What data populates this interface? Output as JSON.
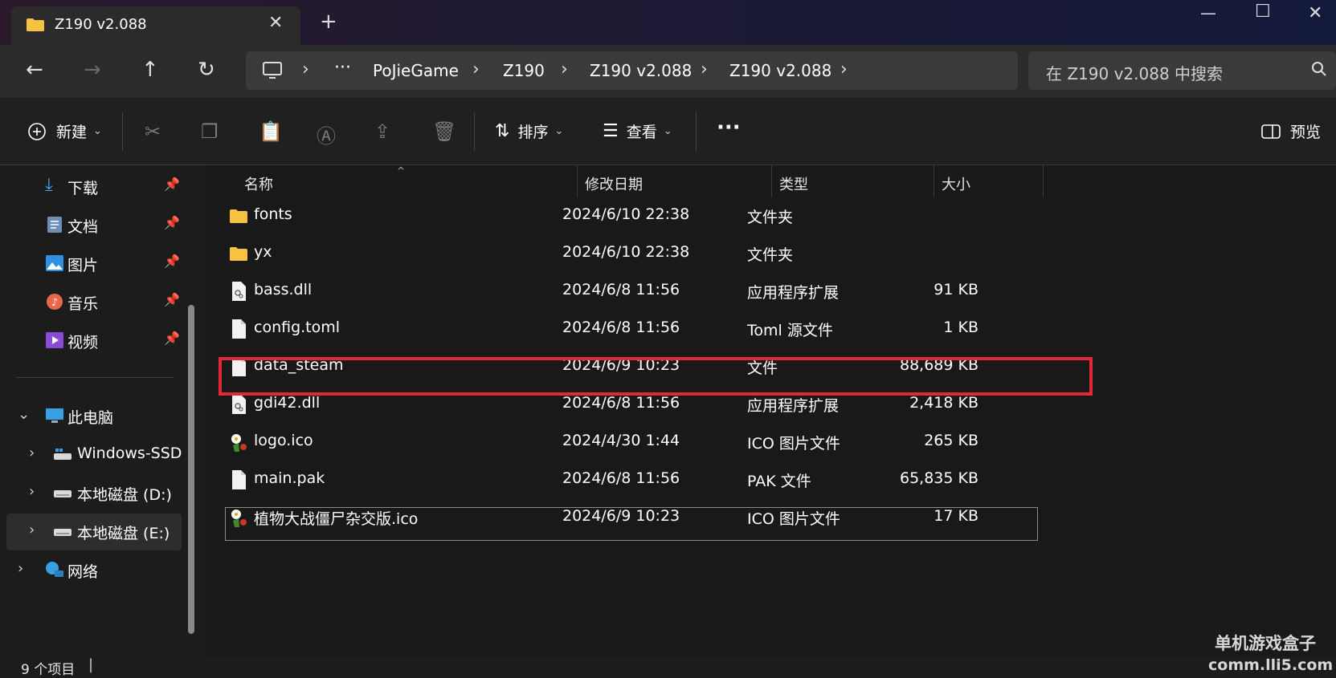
{
  "window": {
    "tab_title": "Z190 v2.088"
  },
  "breadcrumb": [
    "PoJieGame",
    "Z190",
    "Z190 v2.088",
    "Z190 v2.088"
  ],
  "search": {
    "placeholder": "在 Z190 v2.088 中搜索"
  },
  "toolbar": {
    "new_label": "新建",
    "sort_label": "排序",
    "view_label": "查看",
    "preview_label": "预览"
  },
  "sidebar": {
    "quick_access": [
      {
        "label": "下载",
        "icon": "download-icon"
      },
      {
        "label": "文档",
        "icon": "document-icon"
      },
      {
        "label": "图片",
        "icon": "picture-icon"
      },
      {
        "label": "音乐",
        "icon": "music-icon"
      },
      {
        "label": "视频",
        "icon": "video-icon"
      }
    ],
    "this_pc": "此电脑",
    "drives": [
      "Windows-SSD (",
      "本地磁盘 (D:)",
      "本地磁盘 (E:)"
    ],
    "network": "网络"
  },
  "columns": {
    "name": "名称",
    "date": "修改日期",
    "type": "类型",
    "size": "大小"
  },
  "files": [
    {
      "name": "fonts",
      "date": "2024/6/10 22:38",
      "type": "文件夹",
      "size": "",
      "icon": "folder-icon"
    },
    {
      "name": "yx",
      "date": "2024/6/10 22:38",
      "type": "文件夹",
      "size": "",
      "icon": "folder-icon"
    },
    {
      "name": "bass.dll",
      "date": "2024/6/8 11:56",
      "type": "应用程序扩展",
      "size": "91 KB",
      "icon": "dll-icon"
    },
    {
      "name": "config.toml",
      "date": "2024/6/8 11:56",
      "type": "Toml 源文件",
      "size": "1 KB",
      "icon": "file-icon"
    },
    {
      "name": "data_steam",
      "date": "2024/6/9 10:23",
      "type": "文件",
      "size": "88,689 KB",
      "icon": "file-icon"
    },
    {
      "name": "gdi42.dll",
      "date": "2024/6/8 11:56",
      "type": "应用程序扩展",
      "size": "2,418 KB",
      "icon": "dll-icon"
    },
    {
      "name": "logo.ico",
      "date": "2024/4/30 1:44",
      "type": "ICO 图片文件",
      "size": "265 KB",
      "icon": "ico-icon"
    },
    {
      "name": "main.pak",
      "date": "2024/6/8 11:56",
      "type": "PAK 文件",
      "size": "65,835 KB",
      "icon": "file-icon"
    },
    {
      "name": "植物大战僵尸杂交版.ico",
      "date": "2024/6/9 10:23",
      "type": "ICO 图片文件",
      "size": "17 KB",
      "icon": "ico-icon"
    }
  ],
  "status": {
    "item_count": "9 个项目"
  },
  "watermark": {
    "line1": "单机游戏盒子",
    "line2": "comm.lli5.com"
  },
  "colors": {
    "highlight": "#e0283a",
    "folder": "#f5c242",
    "accent": "#4aa3f0"
  }
}
